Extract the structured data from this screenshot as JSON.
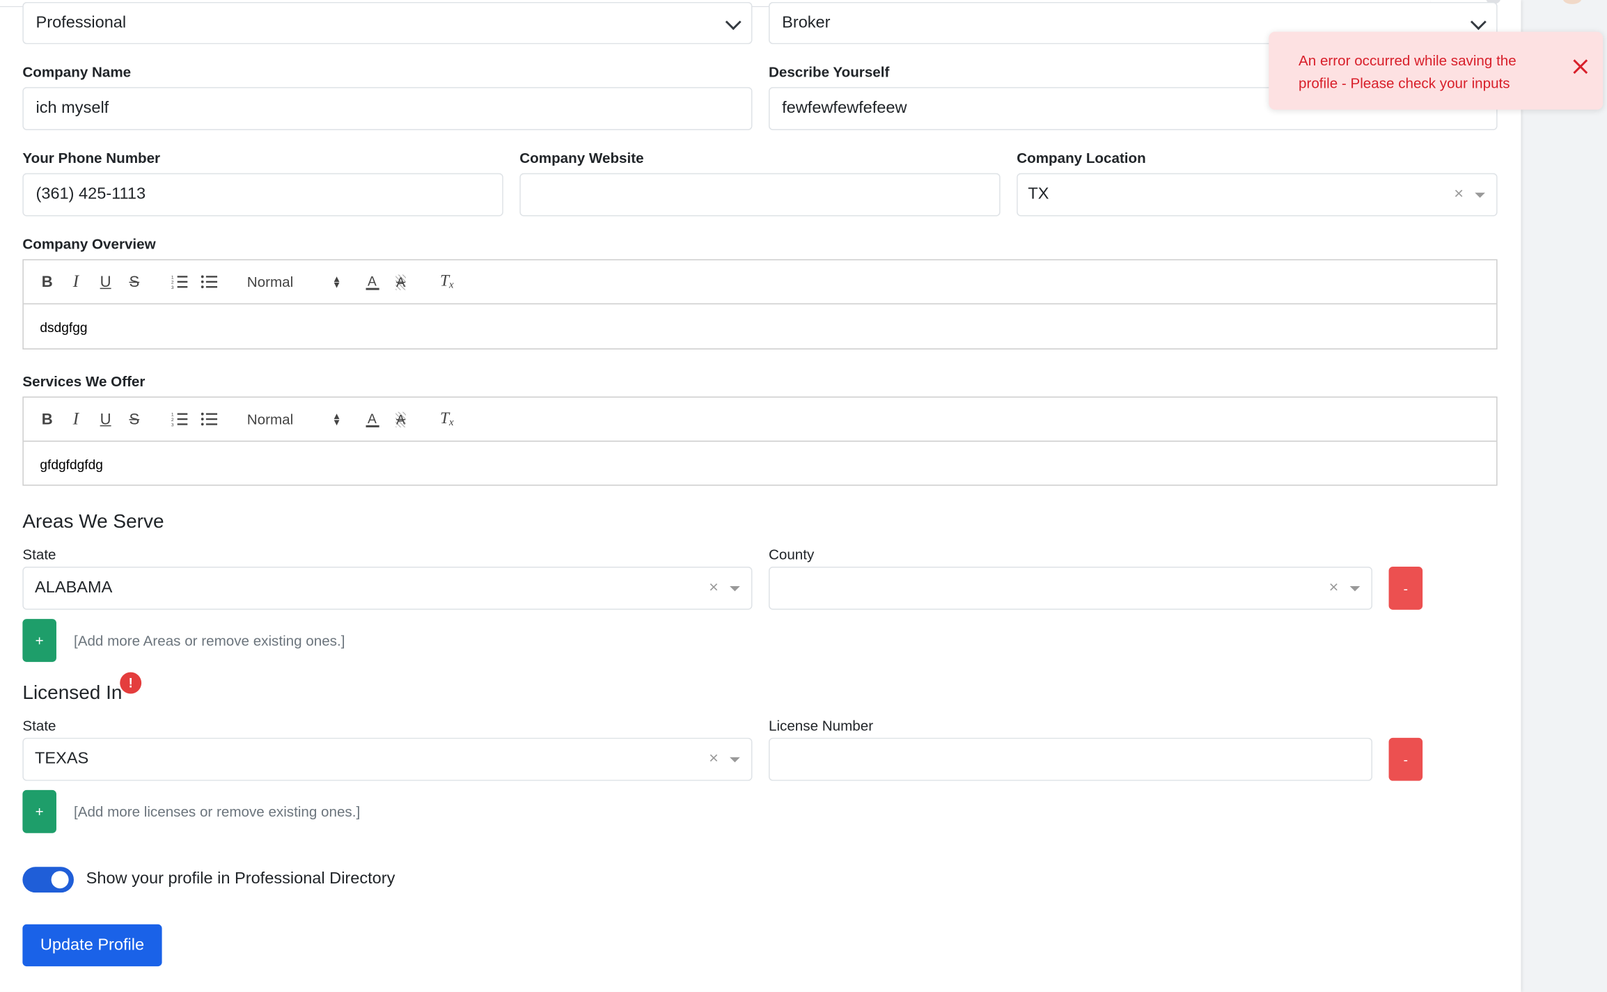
{
  "profile": {
    "type_value": "Professional",
    "role_value": "Broker",
    "company_name": {
      "label": "Company Name",
      "value": "ich myself"
    },
    "describe_yourself": {
      "label": "Describe Yourself",
      "value": "fewfewfewfefeew"
    },
    "phone": {
      "label": "Your Phone Number",
      "value": "(361) 425-1113"
    },
    "website": {
      "label": "Company Website",
      "value": ""
    },
    "location": {
      "label": "Company Location",
      "value": "TX"
    }
  },
  "editors": {
    "overview": {
      "label": "Company Overview",
      "content": "dsdgfgg"
    },
    "services": {
      "label": "Services We Offer",
      "content": "gfdgfdgfdg"
    },
    "toolbar": {
      "bold": "B",
      "italic": "I",
      "underline": "U",
      "strike": "S",
      "header_select": "Normal",
      "color": "A",
      "background": "A",
      "clean": "T"
    }
  },
  "areas": {
    "heading": "Areas We Serve",
    "state_label": "State",
    "county_label": "County",
    "state_value": "ALABAMA",
    "county_value": "",
    "remove_label": "-",
    "add_label": "+",
    "hint": "[Add more Areas or remove existing ones.]"
  },
  "licenses": {
    "heading": "Licensed In",
    "alert": "!",
    "state_label": "State",
    "number_label": "License Number",
    "state_value": "TEXAS",
    "number_value": "",
    "remove_label": "-",
    "add_label": "+",
    "hint": "[Add more licenses or remove existing ones.]"
  },
  "directory_toggle": {
    "label": "Show your profile in Professional Directory",
    "on": true
  },
  "update_button": "Update Profile",
  "toast": {
    "message": "An error occurred while saving the profile - Please check your inputs"
  },
  "colors": {
    "primary": "#1a62e8",
    "success": "#1e9e6a",
    "danger": "#ec5050",
    "toast_bg": "#fde1e2",
    "toast_text": "#d81f2a"
  }
}
